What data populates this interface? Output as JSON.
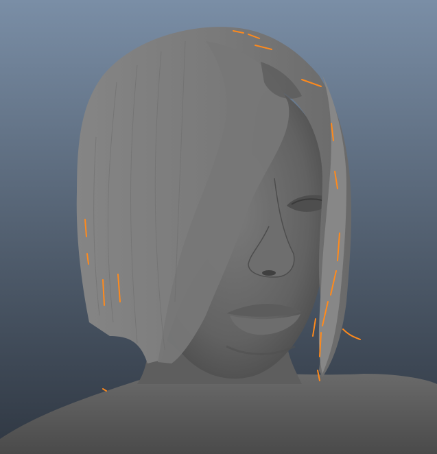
{
  "viewport": {
    "background_top": "#7a8ea6",
    "background_bottom": "#2f3742",
    "skin_color": "#6b6b6b",
    "hair_color": "#7d7d7d",
    "hair_shadow": "#5a5a5a",
    "selection_color": "#ff8a1c",
    "icons": [
      "3d-head-model",
      "hair-mesh",
      "selected-hair-guides"
    ]
  }
}
